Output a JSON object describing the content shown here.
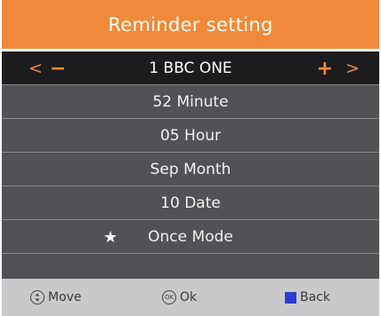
{
  "header": {
    "title": "Reminder setting"
  },
  "rows": [
    {
      "label": "1 BBC ONE",
      "selected": true,
      "left_arrow": "<",
      "left_minus": "−",
      "right_plus": "+",
      "right_arrow": ">"
    },
    {
      "label": "52 Minute"
    },
    {
      "label": "05 Hour"
    },
    {
      "label": "Sep Month"
    },
    {
      "label": "10 Date"
    },
    {
      "label": "Once Mode",
      "star": "★"
    }
  ],
  "footer": {
    "move_label": "Move",
    "ok_label": "Ok",
    "ok_icon_text": "OK",
    "back_label": "Back"
  },
  "colors": {
    "accent": "#f08a3a",
    "row_bg": "#525256",
    "selected_bg": "#1c1c1e",
    "footer_bg": "#c9c9cb",
    "back_icon": "#2a3fd0"
  }
}
